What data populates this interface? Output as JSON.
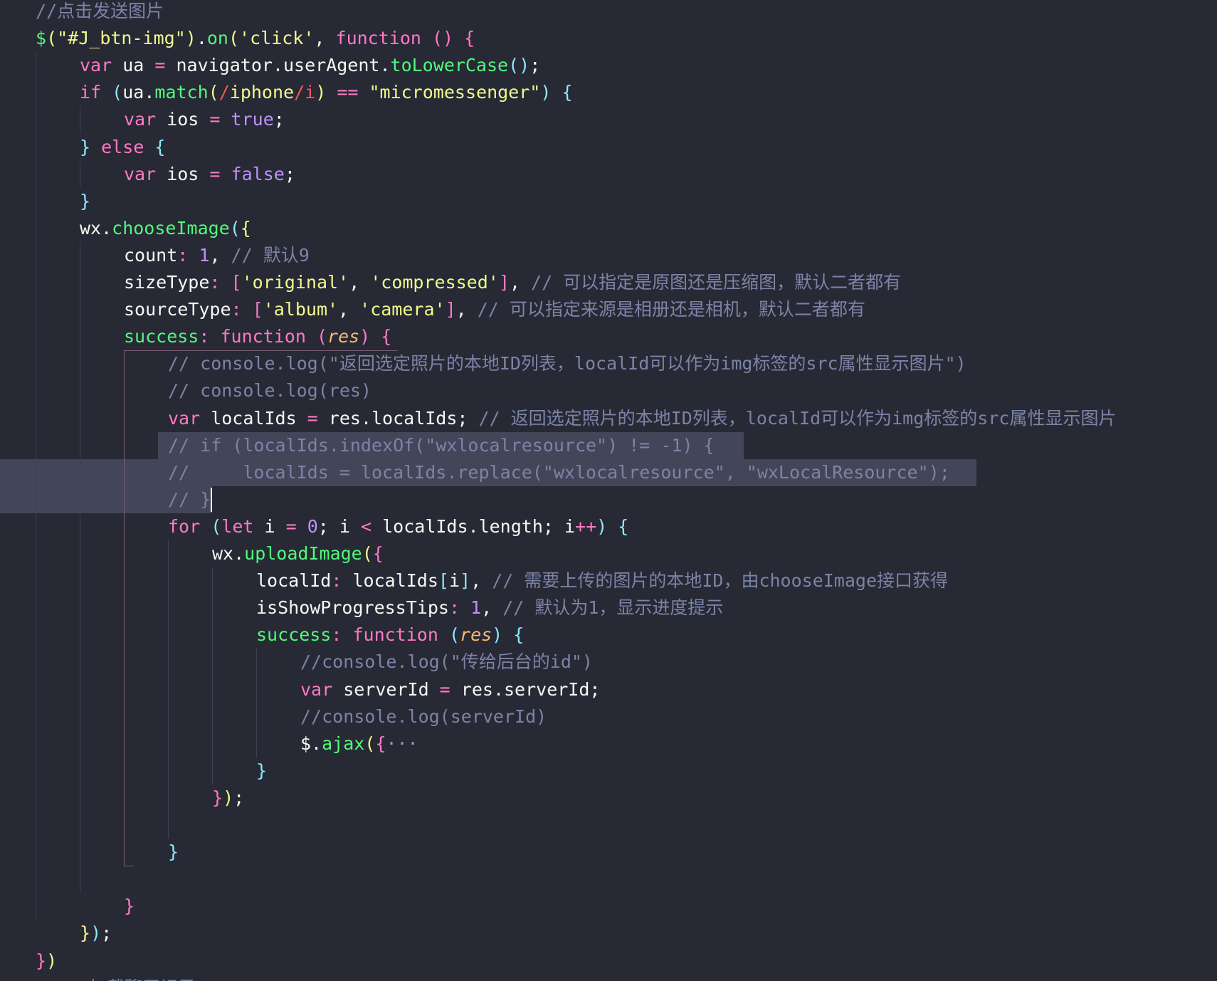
{
  "editor": {
    "lines": [
      {
        "indent": 0,
        "selection": null,
        "tokens": [
          {
            "t": "//点击发送图片",
            "c": "cm"
          }
        ]
      },
      {
        "indent": 0,
        "selection": null,
        "tokens": [
          {
            "t": "$",
            "c": "fn"
          },
          {
            "t": "(",
            "c": "br1"
          },
          {
            "t": "\"#J_btn-img\"",
            "c": "str"
          },
          {
            "t": ")",
            "c": "br1"
          },
          {
            "t": ".",
            "c": "pun"
          },
          {
            "t": "on",
            "c": "fn"
          },
          {
            "t": "(",
            "c": "br1"
          },
          {
            "t": "'click'",
            "c": "str"
          },
          {
            "t": ", ",
            "c": "pun"
          },
          {
            "t": "function",
            "c": "kw"
          },
          {
            "t": " ",
            "c": "pun"
          },
          {
            "t": "()",
            "c": "br2"
          },
          {
            "t": " ",
            "c": "pun"
          },
          {
            "t": "{",
            "c": "br2"
          }
        ]
      },
      {
        "indent": 1,
        "selection": null,
        "tokens": [
          {
            "t": "var",
            "c": "kw"
          },
          {
            "t": " ua ",
            "c": "prop"
          },
          {
            "t": "=",
            "c": "op"
          },
          {
            "t": " navigator.userAgent.",
            "c": "prop"
          },
          {
            "t": "toLowerCase",
            "c": "fn"
          },
          {
            "t": "()",
            "c": "br3"
          },
          {
            "t": ";",
            "c": "pun"
          }
        ]
      },
      {
        "indent": 1,
        "selection": null,
        "tokens": [
          {
            "t": "if",
            "c": "kw"
          },
          {
            "t": " ",
            "c": "pun"
          },
          {
            "t": "(",
            "c": "br3"
          },
          {
            "t": "ua.",
            "c": "prop"
          },
          {
            "t": "match",
            "c": "fn"
          },
          {
            "t": "(",
            "c": "br1"
          },
          {
            "t": "/",
            "c": "reg"
          },
          {
            "t": "iphone",
            "c": "str"
          },
          {
            "t": "/i",
            "c": "reg"
          },
          {
            "t": ")",
            "c": "br1"
          },
          {
            "t": " ",
            "c": "pun"
          },
          {
            "t": "==",
            "c": "op"
          },
          {
            "t": " ",
            "c": "pun"
          },
          {
            "t": "\"micromessenger\"",
            "c": "str"
          },
          {
            "t": ")",
            "c": "br3"
          },
          {
            "t": " ",
            "c": "pun"
          },
          {
            "t": "{",
            "c": "br3"
          }
        ]
      },
      {
        "indent": 2,
        "selection": null,
        "tokens": [
          {
            "t": "var",
            "c": "kw"
          },
          {
            "t": " ios ",
            "c": "prop"
          },
          {
            "t": "=",
            "c": "op"
          },
          {
            "t": " ",
            "c": "pun"
          },
          {
            "t": "true",
            "c": "num"
          },
          {
            "t": ";",
            "c": "pun"
          }
        ]
      },
      {
        "indent": 1,
        "selection": null,
        "tokens": [
          {
            "t": "}",
            "c": "br3"
          },
          {
            "t": " ",
            "c": "pun"
          },
          {
            "t": "else",
            "c": "kw"
          },
          {
            "t": " ",
            "c": "pun"
          },
          {
            "t": "{",
            "c": "br3"
          }
        ]
      },
      {
        "indent": 2,
        "selection": null,
        "tokens": [
          {
            "t": "var",
            "c": "kw"
          },
          {
            "t": " ios ",
            "c": "prop"
          },
          {
            "t": "=",
            "c": "op"
          },
          {
            "t": " ",
            "c": "pun"
          },
          {
            "t": "false",
            "c": "num"
          },
          {
            "t": ";",
            "c": "pun"
          }
        ]
      },
      {
        "indent": 1,
        "selection": null,
        "tokens": [
          {
            "t": "}",
            "c": "br3"
          }
        ]
      },
      {
        "indent": 1,
        "selection": null,
        "tokens": [
          {
            "t": "wx.",
            "c": "prop"
          },
          {
            "t": "chooseImage",
            "c": "fn"
          },
          {
            "t": "(",
            "c": "br3"
          },
          {
            "t": "{",
            "c": "br1"
          }
        ]
      },
      {
        "indent": 2,
        "selection": null,
        "tokens": [
          {
            "t": "count",
            "c": "prop"
          },
          {
            "t": ": ",
            "c": "op"
          },
          {
            "t": "1",
            "c": "num"
          },
          {
            "t": ", ",
            "c": "pun"
          },
          {
            "t": "// 默认9",
            "c": "cm"
          }
        ]
      },
      {
        "indent": 2,
        "selection": null,
        "tokens": [
          {
            "t": "sizeType",
            "c": "prop"
          },
          {
            "t": ": ",
            "c": "op"
          },
          {
            "t": "[",
            "c": "br2"
          },
          {
            "t": "'original'",
            "c": "str"
          },
          {
            "t": ", ",
            "c": "pun"
          },
          {
            "t": "'compressed'",
            "c": "str"
          },
          {
            "t": "]",
            "c": "br2"
          },
          {
            "t": ", ",
            "c": "pun"
          },
          {
            "t": "// 可以指定是原图还是压缩图，默认二者都有",
            "c": "cm"
          }
        ]
      },
      {
        "indent": 2,
        "selection": null,
        "tokens": [
          {
            "t": "sourceType",
            "c": "prop"
          },
          {
            "t": ": ",
            "c": "op"
          },
          {
            "t": "[",
            "c": "br2"
          },
          {
            "t": "'album'",
            "c": "str"
          },
          {
            "t": ", ",
            "c": "pun"
          },
          {
            "t": "'camera'",
            "c": "str"
          },
          {
            "t": "]",
            "c": "br2"
          },
          {
            "t": ", ",
            "c": "pun"
          },
          {
            "t": "// 可以指定来源是相册还是相机，默认二者都有",
            "c": "cm"
          }
        ]
      },
      {
        "indent": 2,
        "selection": null,
        "tokens": [
          {
            "t": "success",
            "c": "fn"
          },
          {
            "t": ": ",
            "c": "op"
          },
          {
            "t": "function",
            "c": "kw"
          },
          {
            "t": " ",
            "c": "pun"
          },
          {
            "t": "(",
            "c": "br2"
          },
          {
            "t": "res",
            "c": "prm"
          },
          {
            "t": ")",
            "c": "br2"
          },
          {
            "t": " ",
            "c": "pun"
          },
          {
            "t": "{",
            "c": "br2"
          }
        ]
      },
      {
        "indent": 3,
        "selection": null,
        "tokens": [
          {
            "t": "// console.log(\"返回选定照片的本地ID列表，localId可以作为img标签的src属性显示图片\")",
            "c": "cm"
          }
        ]
      },
      {
        "indent": 3,
        "selection": null,
        "tokens": [
          {
            "t": "// console.log(res)",
            "c": "cm"
          }
        ]
      },
      {
        "indent": 3,
        "selection": null,
        "tokens": [
          {
            "t": "var",
            "c": "kw"
          },
          {
            "t": " localIds ",
            "c": "prop"
          },
          {
            "t": "=",
            "c": "op"
          },
          {
            "t": " res.localIds",
            "c": "prop"
          },
          {
            "t": "; ",
            "c": "pun"
          },
          {
            "t": "// 返回选定照片的本地ID列表，localId可以作为img标签的src属性显示图片",
            "c": "cm"
          }
        ]
      },
      {
        "indent": 3,
        "selection": "text",
        "tokens": [
          {
            "t": "// if (localIds.indexOf(\"wxlocalresource\") != -1) {",
            "c": "cm"
          }
        ]
      },
      {
        "indent": 3,
        "selection": "full",
        "tokens": [
          {
            "t": "//     localIds = localIds.replace(\"wxlocalresource\", \"wxLocalResource\");",
            "c": "cm"
          }
        ]
      },
      {
        "indent": 3,
        "selection": "full-to-cursor",
        "tokens": [
          {
            "t": "// }",
            "c": "cm"
          }
        ]
      },
      {
        "indent": 3,
        "selection": null,
        "tokens": [
          {
            "t": "for",
            "c": "kw"
          },
          {
            "t": " ",
            "c": "pun"
          },
          {
            "t": "(",
            "c": "br3"
          },
          {
            "t": "let",
            "c": "kw"
          },
          {
            "t": " i ",
            "c": "prop"
          },
          {
            "t": "=",
            "c": "op"
          },
          {
            "t": " ",
            "c": "pun"
          },
          {
            "t": "0",
            "c": "num"
          },
          {
            "t": "; i ",
            "c": "prop"
          },
          {
            "t": "<",
            "c": "op"
          },
          {
            "t": " localIds.length; i",
            "c": "prop"
          },
          {
            "t": "++",
            "c": "op"
          },
          {
            "t": ")",
            "c": "br3"
          },
          {
            "t": " ",
            "c": "pun"
          },
          {
            "t": "{",
            "c": "br3"
          }
        ]
      },
      {
        "indent": 4,
        "selection": null,
        "tokens": [
          {
            "t": "wx.",
            "c": "prop"
          },
          {
            "t": "uploadImage",
            "c": "fn"
          },
          {
            "t": "(",
            "c": "br1"
          },
          {
            "t": "{",
            "c": "br2"
          }
        ]
      },
      {
        "indent": 5,
        "selection": null,
        "tokens": [
          {
            "t": "localId",
            "c": "prop"
          },
          {
            "t": ": ",
            "c": "op"
          },
          {
            "t": "localIds",
            "c": "prop"
          },
          {
            "t": "[",
            "c": "br3"
          },
          {
            "t": "i",
            "c": "prop"
          },
          {
            "t": "]",
            "c": "br3"
          },
          {
            "t": ", ",
            "c": "pun"
          },
          {
            "t": "// 需要上传的图片的本地ID，由chooseImage接口获得",
            "c": "cm"
          }
        ]
      },
      {
        "indent": 5,
        "selection": null,
        "tokens": [
          {
            "t": "isShowProgressTips",
            "c": "prop"
          },
          {
            "t": ": ",
            "c": "op"
          },
          {
            "t": "1",
            "c": "num"
          },
          {
            "t": ", ",
            "c": "pun"
          },
          {
            "t": "// 默认为1，显示进度提示",
            "c": "cm"
          }
        ]
      },
      {
        "indent": 5,
        "selection": null,
        "tokens": [
          {
            "t": "success",
            "c": "fn"
          },
          {
            "t": ": ",
            "c": "op"
          },
          {
            "t": "function",
            "c": "kw"
          },
          {
            "t": " ",
            "c": "pun"
          },
          {
            "t": "(",
            "c": "br3"
          },
          {
            "t": "res",
            "c": "prm"
          },
          {
            "t": ")",
            "c": "br3"
          },
          {
            "t": " ",
            "c": "pun"
          },
          {
            "t": "{",
            "c": "br3"
          }
        ]
      },
      {
        "indent": 6,
        "selection": null,
        "tokens": [
          {
            "t": "//console.log(\"传给后台的id\")",
            "c": "cm"
          }
        ]
      },
      {
        "indent": 6,
        "selection": null,
        "tokens": [
          {
            "t": "var",
            "c": "kw"
          },
          {
            "t": " serverId ",
            "c": "prop"
          },
          {
            "t": "=",
            "c": "op"
          },
          {
            "t": " res.serverId",
            "c": "prop"
          },
          {
            "t": ";",
            "c": "pun"
          }
        ]
      },
      {
        "indent": 6,
        "selection": null,
        "tokens": [
          {
            "t": "//console.log(serverId)",
            "c": "cm"
          }
        ]
      },
      {
        "indent": 6,
        "selection": null,
        "tokens": [
          {
            "t": "$.",
            "c": "prop"
          },
          {
            "t": "ajax",
            "c": "fn"
          },
          {
            "t": "(",
            "c": "br1"
          },
          {
            "t": "{",
            "c": "br2"
          },
          {
            "t": "···",
            "c": "fold"
          }
        ]
      },
      {
        "indent": 5,
        "selection": null,
        "tokens": [
          {
            "t": "}",
            "c": "br3"
          }
        ]
      },
      {
        "indent": 4,
        "selection": null,
        "tokens": [
          {
            "t": "}",
            "c": "br2"
          },
          {
            "t": ")",
            "c": "br1"
          },
          {
            "t": ";",
            "c": "pun"
          }
        ]
      },
      {
        "indent": 0,
        "selection": null,
        "tokens": []
      },
      {
        "indent": 3,
        "selection": null,
        "tokens": [
          {
            "t": "}",
            "c": "br3"
          }
        ]
      },
      {
        "indent": 0,
        "selection": null,
        "tokens": []
      },
      {
        "indent": 2,
        "selection": null,
        "tokens": [
          {
            "t": "}",
            "c": "br2"
          }
        ]
      },
      {
        "indent": 1,
        "selection": null,
        "tokens": [
          {
            "t": "}",
            "c": "br1"
          },
          {
            "t": ")",
            "c": "br3"
          },
          {
            "t": ";",
            "c": "pun"
          }
        ]
      },
      {
        "indent": 0,
        "selection": null,
        "tokens": [
          {
            "t": "}",
            "c": "br2"
          },
          {
            "t": ")",
            "c": "br1"
          }
        ]
      },
      {
        "indent": 0,
        "selection": null,
        "tokens": [
          {
            "t": "// //加载聊天记录",
            "c": "cm"
          }
        ]
      }
    ]
  },
  "colors": {
    "background": "#272935",
    "selection": "#424658",
    "keyword": "#ff79c6",
    "function": "#50fa7b",
    "string": "#f1fa8c",
    "number": "#bd93f9",
    "comment": "#7c83a6",
    "parameter": "#ffb86c"
  }
}
